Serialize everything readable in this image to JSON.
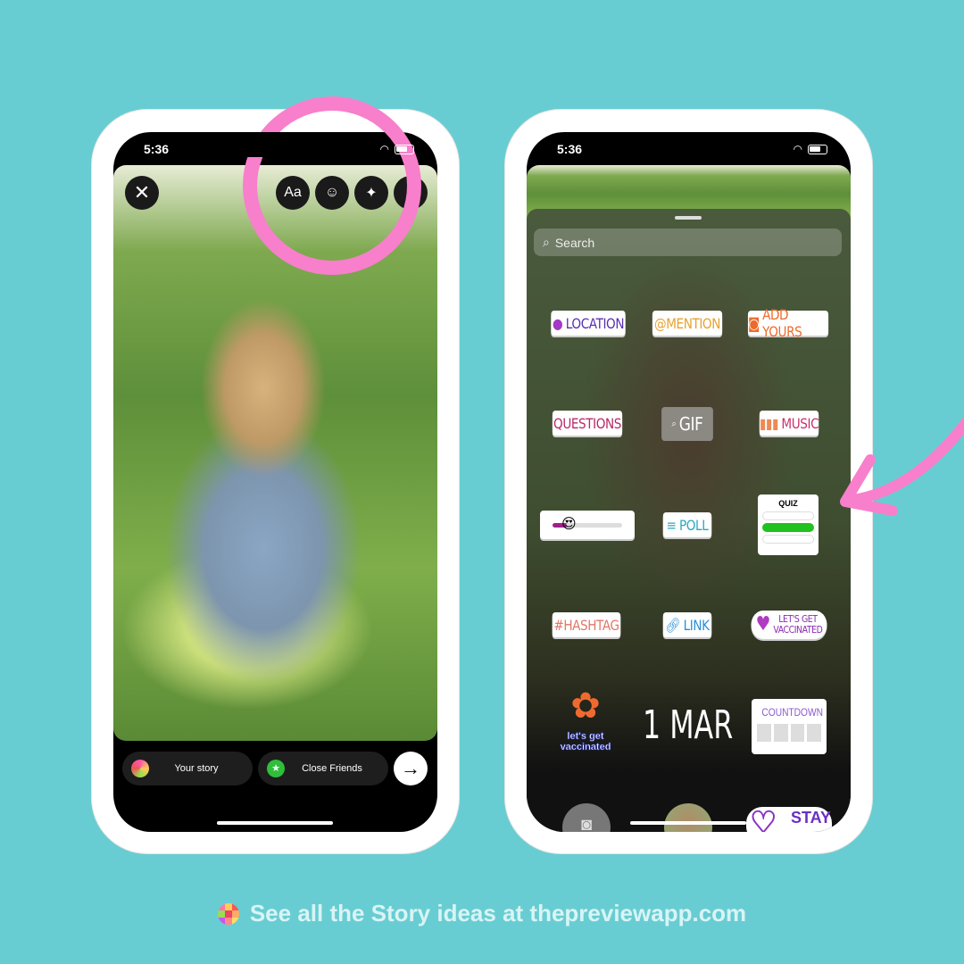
{
  "left_phone": {
    "time": "5:36",
    "tools": {
      "text": "Aa",
      "sticker": "sticker-icon",
      "effects": "sparkles-icon"
    },
    "share": {
      "your_story": "Your story",
      "close_friends": "Close Friends"
    }
  },
  "right_phone": {
    "time": "5:36",
    "search_placeholder": "Search",
    "stickers": {
      "location": "LOCATION",
      "mention": "@MENTION",
      "add_yours": "ADD YOURS",
      "questions": "QUESTIONS",
      "gif": "GIF",
      "music": "MUSIC",
      "poll": "POLL",
      "quiz": "QUIZ",
      "hashtag": "#HASHTAG",
      "link": "LINK",
      "vaccinated_line1": "LET'S GET",
      "vaccinated_line2": "VACCINATED",
      "lets_get_vaccinated": "let's get vaccinated",
      "date": "1 MAR",
      "countdown": "COUNTDOWN",
      "stay": "STAY",
      "slider_emoji": "😍"
    }
  },
  "footer": {
    "text": "See all the Story ideas at thepreviewapp.com"
  },
  "colors": {
    "background": "#68cdd2",
    "highlight": "#f87fcb"
  }
}
